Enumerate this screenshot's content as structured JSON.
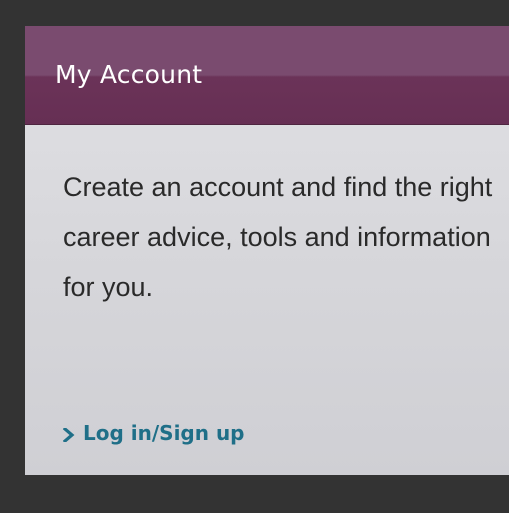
{
  "panel": {
    "title": "My Account",
    "description": "Create an account and find the right career advice, tools and information for you.",
    "link_label": "Log in/Sign up",
    "link_icon": "chevron-right-icon"
  },
  "colors": {
    "page_background": "#333333",
    "header_background": "#6b3358",
    "panel_background": "#d6d6da",
    "link_color": "#1f6f88"
  }
}
